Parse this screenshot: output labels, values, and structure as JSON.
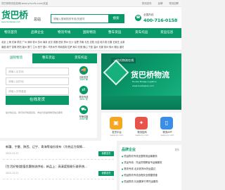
{
  "topbar": {
    "left_text": "货巴桥物流信息网(www.ymcxfs.com)欢迎",
    "links": [
      "物流发布",
      "品牌",
      "物流招聘"
    ]
  },
  "header": {
    "logo_text": "货巴桥",
    "logo_sub": "www.huobaqiao.com",
    "search_label": "总站",
    "search_placeholder": "请输入搜索物流专线/关键词",
    "search_button": "搜索",
    "hotline_label": "全国热线",
    "hotline_number": "400-716-0158"
  },
  "nav": [
    "物流首页",
    "品牌企业",
    "物流专线",
    "国际物流",
    "整车货运",
    "货车托运",
    "货运信息"
  ],
  "cities": {
    "row1": "北京 上海 天津 重庆 广州 深圳 杭州 苏州 南京 武汉 成都 西安 郑州 长沙 合肥 济南 青岛 沈阳 大连 哈尔滨 长春 石家庄 太原",
    "row2": "南昌 南宁 昆明 贵阳 福州 厦门 兰州 西宁 银川 乌鲁木齐 呼和浩特 拉萨 海口 东莞 佛山 宁波 温州 无锡 常州 徐州 烟台 潍坊"
  },
  "panel": {
    "tabs": [
      "国际物流",
      "整车货运",
      "货车托运"
    ],
    "field_from_placeholder": "请输入出发地",
    "field_to_placeholder": "请输入目的地",
    "field_weight_placeholder": "请输入货物重量",
    "submit_label": "在线发货",
    "note": "提交信息后，我们将尽快回复您，本站为您提供物流信息服务",
    "side": [
      {
        "label": "当前发货",
        "num": "1065 单",
        "icon": "truck-icon"
      },
      {
        "label": "物流专线",
        "num": "4651 条",
        "icon": "route-icon"
      },
      {
        "label": "车辆总数",
        "num": "6582 辆",
        "icon": "car-icon"
      }
    ]
  },
  "banner": {
    "slogan": "一站式物流在线",
    "title": "货巴桥物流",
    "sub": "Huoba Bridge Logistics",
    "url": "www.huobaqiao.com"
  },
  "apps": [
    {
      "l1": "发货平台",
      "l2": "www.xx.com",
      "icon": "package-icon",
      "color": "#f5a623"
    },
    {
      "l1": "物流招商",
      "l2": "www.xx.com",
      "icon": "handshake-icon",
      "color": "#e8534a"
    },
    {
      "l1": "物流APP",
      "l2": "www.xx.com",
      "icon": "phone-icon",
      "color": "#3a8ee6"
    }
  ],
  "news": [
    {
      "title": "新疆、宁夏、陕西、辽宁、青海等省份发布（冷热运力保障...",
      "date": "2022-12-21",
      "btn": "我要发货"
    },
    {
      "title": "[生活好物]超值优惠物流供给，新品上：高清度智能行驶系统...",
      "date": "2022-12-21",
      "btn": "我要发货"
    }
  ],
  "brand": {
    "title": "品牌企业",
    "more": "更多",
    "lines": [
      "恒运物流专线全国物流运输服务",
      "货运专线：托运货物跨省市运输服务",
      "物流专线 北京到郑州货运直达",
      "恒运物流专线全程安全便捷快速",
      "恒运物流 长途搬家行李托运服务"
    ]
  }
}
